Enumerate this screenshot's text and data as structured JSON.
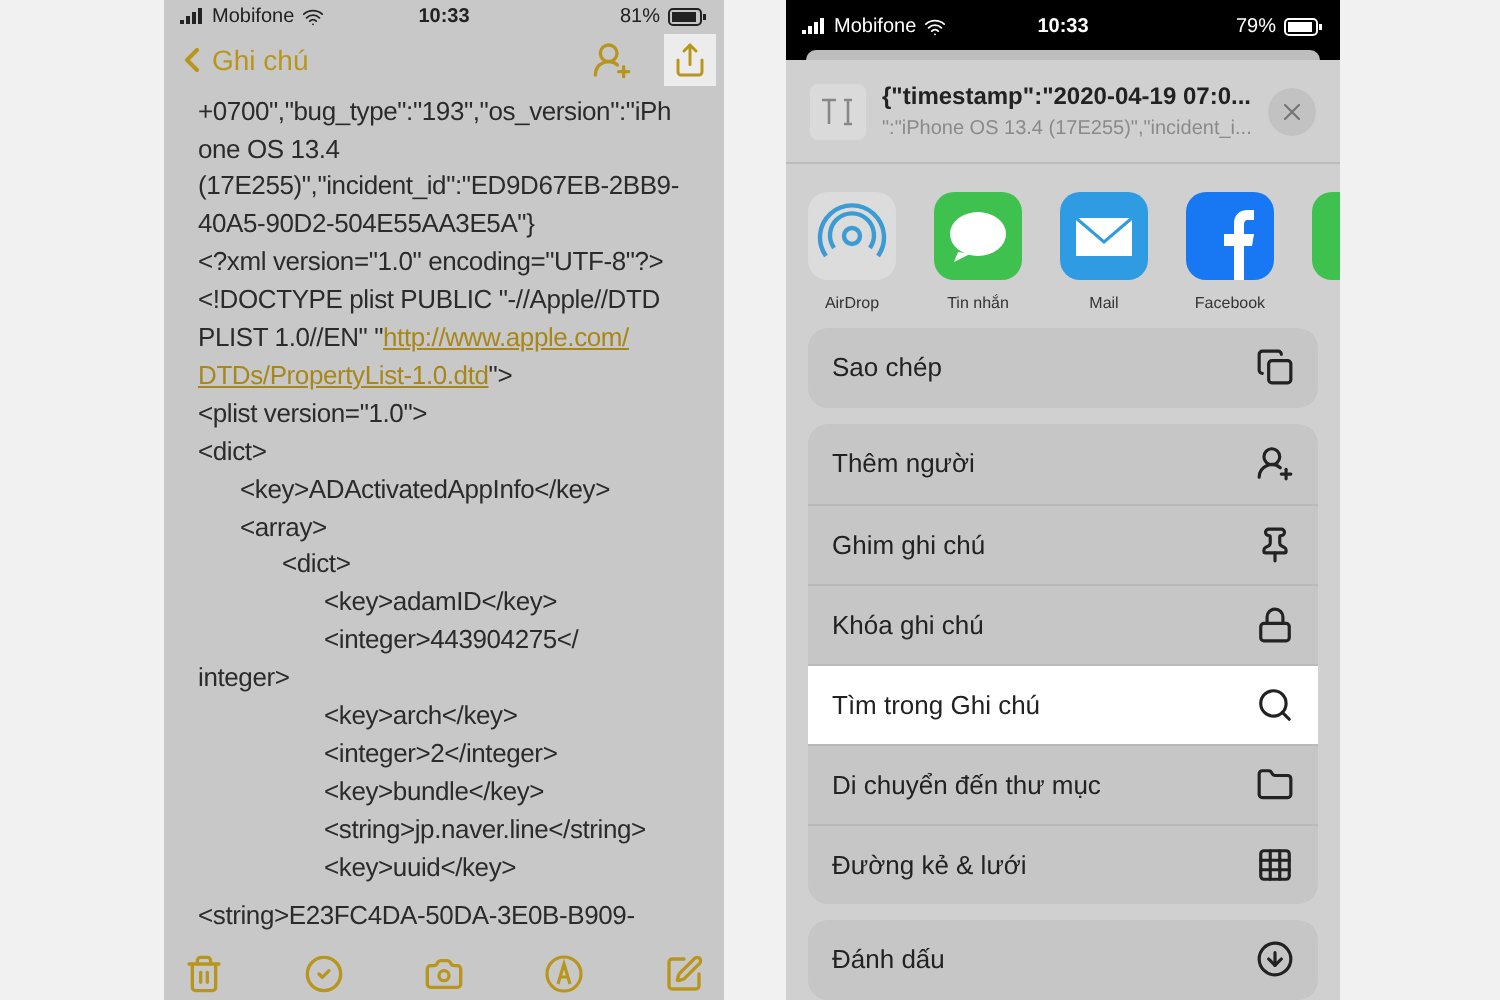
{
  "left_phone": {
    "status_bar": {
      "carrier": "Mobifone",
      "time": "10:33",
      "battery": "81%"
    },
    "nav": {
      "back": "Ghi chú",
      "share_highlighted": true
    },
    "note": [
      {
        "kind": "line",
        "text": "+0700\",\"bug_type\":\"193\",\"os_version\":\"iPh"
      },
      {
        "kind": "line",
        "text": "one OS 13.4"
      },
      {
        "kind": "line",
        "text": "(17E255)\",\"incident_id\":\"ED9D67EB-2BB9-"
      },
      {
        "kind": "line",
        "text": "40A5-90D2-504E55AA3E5A\"}"
      },
      {
        "kind": "line",
        "text": "<?xml version=\"1.0\" encoding=\"UTF-8\"?>"
      },
      {
        "kind": "line",
        "text": "<!DOCTYPE plist PUBLIC \"-//Apple//DTD"
      },
      {
        "kind": "line",
        "parts": [
          {
            "text": "PLIST 1.0//EN\" \"",
            "link": false
          },
          {
            "text": "http://www.apple.com/",
            "link": true
          }
        ]
      },
      {
        "kind": "line",
        "parts": [
          {
            "text": "DTDs/PropertyList-1.0.dtd",
            "link": true
          },
          {
            "text": "\">",
            "link": false
          }
        ]
      },
      {
        "kind": "line",
        "text": "<plist version=\"1.0\">"
      },
      {
        "kind": "line",
        "text": "<dict>",
        "children": [
          {
            "kind": "line",
            "text": "<key>ADActivatedAppInfo</key>"
          },
          {
            "kind": "line",
            "text": "<array>",
            "children": [
              {
                "kind": "line",
                "text": "<dict>",
                "children": [
                  {
                    "kind": "line",
                    "text": "<key>adamID</key>"
                  },
                  {
                    "kind": "line",
                    "text": "<integer>443904275</"
                  },
                  {
                    "kind": "wrap",
                    "text": "integer>"
                  },
                  {
                    "kind": "line",
                    "text": "<key>arch</key>"
                  },
                  {
                    "kind": "line",
                    "text": "<integer>2</integer>"
                  },
                  {
                    "kind": "line",
                    "text": "<key>bundle</key>"
                  },
                  {
                    "kind": "line",
                    "text": "<string>jp.naver.line</string>"
                  },
                  {
                    "kind": "line",
                    "text": "<key>uuid</key>"
                  }
                ]
              }
            ]
          }
        ]
      },
      {
        "kind": "gap",
        "text": "<string>E23FC4DA-50DA-3E0B-B909-"
      }
    ]
  },
  "right_phone": {
    "status_bar": {
      "carrier": "Mobifone",
      "time": "10:33",
      "battery": "79%"
    },
    "header": {
      "title": "{\"timestamp\":\"2020-04-19 07:0...",
      "subtitle": "\":\"iPhone OS 13.4 (17E255)\",\"incident_i..."
    },
    "apps": [
      {
        "name": "AirDrop"
      },
      {
        "name": "Tin nhắn"
      },
      {
        "name": "Mail"
      },
      {
        "name": "Facebook"
      }
    ],
    "groups": [
      [
        {
          "label": "Sao chép",
          "selected": false
        }
      ],
      [
        {
          "label": "Thêm người",
          "selected": false
        },
        {
          "label": "Ghim ghi chú",
          "selected": false
        },
        {
          "label": "Khóa ghi chú",
          "selected": false
        },
        {
          "label": "Tìm trong Ghi chú",
          "selected": true
        },
        {
          "label": "Di chuyển đến thư mục",
          "selected": false
        },
        {
          "label": "Đường kẻ & lưới",
          "selected": false
        }
      ],
      [
        {
          "label": "Đánh dấu",
          "selected": false
        }
      ]
    ]
  }
}
